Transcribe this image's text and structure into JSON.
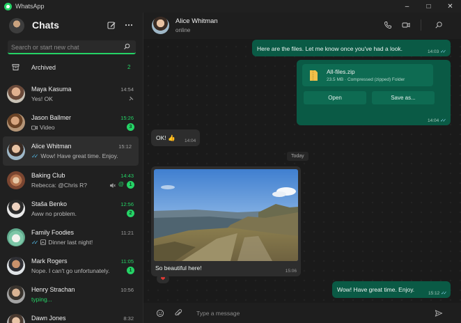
{
  "window": {
    "app_name": "WhatsApp",
    "controls": {
      "minimize": "–",
      "maximize": "□",
      "close": "✕"
    }
  },
  "sidebar": {
    "title": "Chats",
    "search_placeholder": "Search or start new chat",
    "archived": {
      "label": "Archived",
      "count": "2"
    },
    "chats": [
      {
        "name": "Maya Kasuma",
        "time": "14:54",
        "preview": "Yes! OK",
        "pinned": true
      },
      {
        "name": "Jason Ballmer",
        "time": "15:26",
        "preview": "Video",
        "unread": "3"
      },
      {
        "name": "Alice Whitman",
        "time": "15:12",
        "preview": "Wow! Have great time. Enjoy.",
        "active": true
      },
      {
        "name": "Baking Club",
        "time": "14:43",
        "preview": "Rebecca: @Chris R?",
        "unread": "1",
        "muted": true,
        "mention": true
      },
      {
        "name": "Staša Benko",
        "time": "12:56",
        "preview": "Aww no problem.",
        "unread": "2"
      },
      {
        "name": "Family Foodies",
        "time": "11:21",
        "preview": "Dinner last night!"
      },
      {
        "name": "Mark Rogers",
        "time": "11:05",
        "preview": "Nope. I can't go unfortunately.",
        "unread": "1"
      },
      {
        "name": "Henry Strachan",
        "time": "10:56",
        "preview": "typing..."
      },
      {
        "name": "Dawn Jones",
        "time": "8:32",
        "preview": ""
      }
    ]
  },
  "conversation": {
    "contact_name": "Alice Whitman",
    "contact_status": "online",
    "messages": {
      "m1": {
        "text": "Here are the files. Let me know once you've had a look.",
        "time": "14:03"
      },
      "file": {
        "name": "All-files.zip",
        "meta": "23.5 MB · Compressed (zipped) Folder",
        "open_label": "Open",
        "save_label": "Save as...",
        "time": "14:04"
      },
      "m2": {
        "text": "OK! 👍",
        "time": "14:04"
      },
      "day": "Today",
      "photo": {
        "caption": "So beautiful here!",
        "time": "15:06",
        "reaction": "❤"
      },
      "m3": {
        "text": "Wow! Have great time. Enjoy.",
        "time": "15:12"
      }
    },
    "composer_placeholder": "Type a message"
  }
}
